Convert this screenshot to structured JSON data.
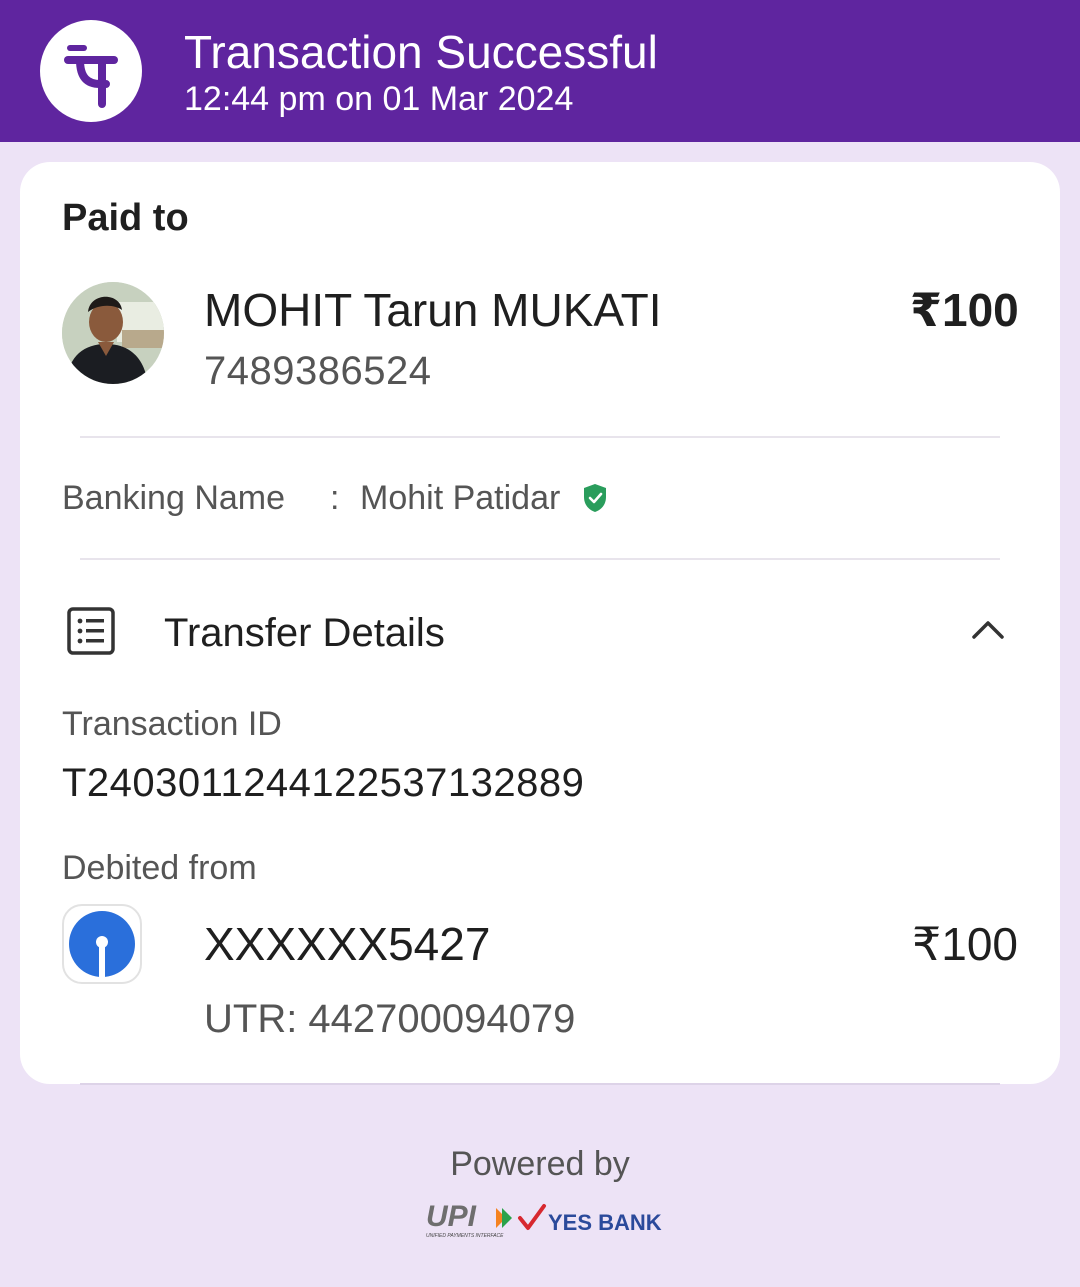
{
  "header": {
    "title": "Transaction Successful",
    "timestamp": "12:44 pm on 01 Mar 2024",
    "brand_color": "#5f259f",
    "logo_icon": "phonepe-logo-icon"
  },
  "payee": {
    "section_label": "Paid to",
    "name": "MOHIT Tarun MUKATI",
    "phone": "7489386524",
    "amount": "₹100",
    "avatar": "profile-photo"
  },
  "banking": {
    "label": "Banking Name",
    "separator": ":",
    "value": "Mohit Patidar",
    "verified_icon": "verified-shield-icon",
    "verified_color": "#2a9d5c"
  },
  "transfer": {
    "title": "Transfer Details",
    "icon": "receipt-list-icon",
    "toggle_icon": "chevron-up-icon",
    "transaction_id_label": "Transaction ID",
    "transaction_id": "T2403011244122537132889",
    "debited_label": "Debited from",
    "account": "XXXXXX5427",
    "account_amount": "₹100",
    "utr": "UTR: 442700094079",
    "bank_icon": "sbi-bank-icon",
    "bank_color": "#2a6fdb"
  },
  "footer": {
    "powered_by": "Powered by",
    "upi_text": "UPI",
    "upi_subtext": "UNIFIED PAYMENTS INTERFACE",
    "bank_text": "YES BANK"
  }
}
